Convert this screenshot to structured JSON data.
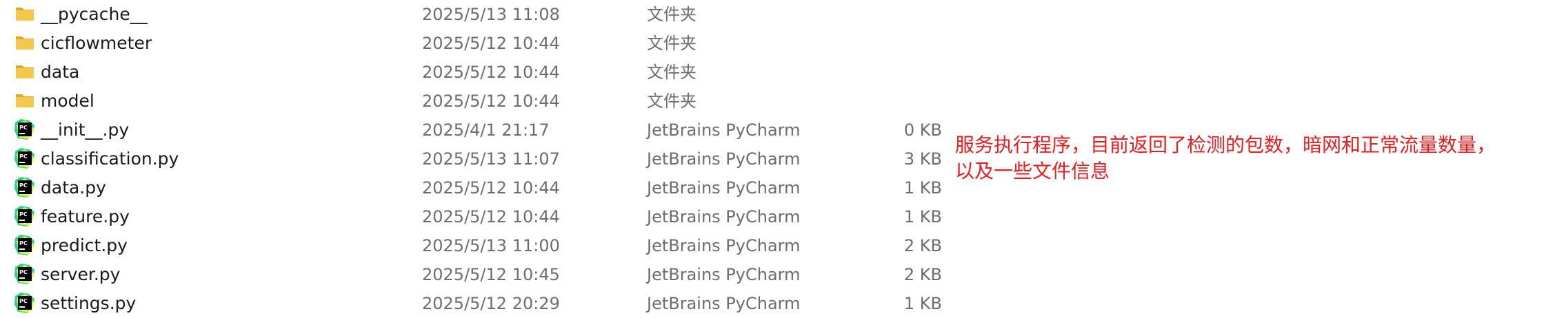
{
  "files": [
    {
      "icon": "folder-icon",
      "name": "__pycache__",
      "date": "2025/5/13 11:08",
      "type": "文件夹",
      "size": ""
    },
    {
      "icon": "folder-icon",
      "name": "cicflowmeter",
      "date": "2025/5/12 10:44",
      "type": "文件夹",
      "size": ""
    },
    {
      "icon": "folder-icon",
      "name": "data",
      "date": "2025/5/12 10:44",
      "type": "文件夹",
      "size": ""
    },
    {
      "icon": "folder-icon",
      "name": "model",
      "date": "2025/5/12 10:44",
      "type": "文件夹",
      "size": ""
    },
    {
      "icon": "pycharm-file-icon",
      "name": "__init__.py",
      "date": "2025/4/1 21:17",
      "type": "JetBrains PyCharm",
      "size": "0 KB"
    },
    {
      "icon": "pycharm-file-icon",
      "name": "classification.py",
      "date": "2025/5/13 11:07",
      "type": "JetBrains PyCharm",
      "size": "3 KB"
    },
    {
      "icon": "pycharm-file-icon",
      "name": "data.py",
      "date": "2025/5/12 10:44",
      "type": "JetBrains PyCharm",
      "size": "1 KB"
    },
    {
      "icon": "pycharm-file-icon",
      "name": "feature.py",
      "date": "2025/5/12 10:44",
      "type": "JetBrains PyCharm",
      "size": "1 KB"
    },
    {
      "icon": "pycharm-file-icon",
      "name": "predict.py",
      "date": "2025/5/13 11:00",
      "type": "JetBrains PyCharm",
      "size": "2 KB"
    },
    {
      "icon": "pycharm-file-icon",
      "name": "server.py",
      "date": "2025/5/12 10:45",
      "type": "JetBrains PyCharm",
      "size": "2 KB"
    },
    {
      "icon": "pycharm-file-icon",
      "name": "settings.py",
      "date": "2025/5/12 20:29",
      "type": "JetBrains PyCharm",
      "size": "1 KB"
    }
  ],
  "annotation": {
    "line1": "服务执行程序，目前返回了检测的包数，暗网和正常流量数量，",
    "line2": "以及一些文件信息"
  },
  "colors": {
    "folder": "#f4c84a",
    "pycharm_bg": "#000000",
    "pycharm_accent": "#21d789",
    "annotation": "#ee1c1c"
  }
}
